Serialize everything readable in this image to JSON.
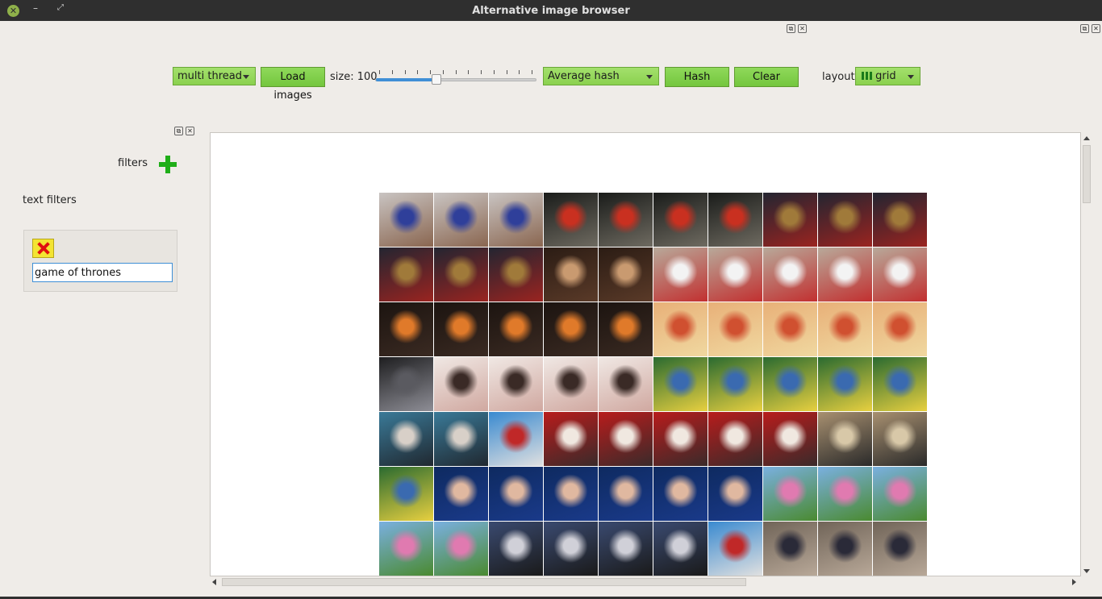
{
  "window": {
    "title": "Alternative image browser",
    "close_glyph": "✕",
    "minimize_glyph": "–",
    "maximize_glyph": "⤢"
  },
  "dock": {
    "float_glyph": "⧉",
    "close_glyph": "✕"
  },
  "toolbar": {
    "thread_mode": "multi thread",
    "load_button": "Load images",
    "size_label": "size: 100",
    "size_value": 100,
    "slider_fraction": 0.38,
    "hash_method": "Average hash",
    "hash_button": "Hash",
    "clear_button": "Clear",
    "layout_label": "layout",
    "layout_value": "grid",
    "layout_icon": "grid-icon"
  },
  "sidebar": {
    "filters_label": "filters",
    "add_icon": "plus-icon",
    "text_filters_label": "text filters",
    "filter_item": {
      "remove_icon": "x-icon",
      "value": "game of thrones"
    }
  },
  "grid": {
    "columns": 10,
    "thumbnails": [
      [
        "phone-hand",
        "phone-hand",
        "phone-hand",
        "scoreboard",
        "scoreboard",
        "scoreboard",
        "scoreboard",
        "arcade-machine",
        "arcade-machine",
        "arcade-machine"
      ],
      [
        "arcade-machine",
        "arcade-machine",
        "arcade-machine",
        "portrait-woman",
        "portrait-woman",
        "football-player",
        "football-player",
        "football-player",
        "football-player",
        "football-player"
      ],
      [
        "fire-cave",
        "fire-cave",
        "fire-cave",
        "fire-cave",
        "fire-cave",
        "cartoon-battle",
        "cartoon-battle",
        "cartoon-battle",
        "cartoon-battle",
        "cartoon-battle"
      ],
      [
        "vr-dark",
        "man-silhouette",
        "man-silhouette",
        "man-silhouette",
        "man-silhouette",
        "toy-garden",
        "toy-garden",
        "toy-garden",
        "toy-garden",
        "toy-garden"
      ],
      [
        "vr-headset",
        "vr-headset",
        "soccer-highfive",
        "crowd-red",
        "crowd-red",
        "crowd-red",
        "crowd-red",
        "crowd-red",
        "boxes-sign",
        "boxes-sign"
      ],
      [
        "toy-garden",
        "man-blue-suit",
        "man-blue-suit",
        "man-blue-suit",
        "man-blue-suit",
        "man-blue-suit",
        "man-blue-suit",
        "city-festival",
        "city-festival",
        "city-festival"
      ],
      [
        "city-festival",
        "city-festival",
        "sprinter-stadium",
        "sprinter-stadium",
        "sprinter-stadium",
        "sprinter-stadium",
        "soccer-highfive",
        "wheelchair-racer",
        "wheelchair-racer",
        "wheelchair-racer"
      ]
    ]
  },
  "thumb_colors": {
    "phone-hand": [
      "#c9c4c2",
      "#2f3f9a",
      "#8a6650"
    ],
    "scoreboard": [
      "#1a1c1a",
      "#c93020",
      "#6e6a60"
    ],
    "arcade-machine": [
      "#232531",
      "#a07a3a",
      "#9a2420"
    ],
    "portrait-woman": [
      "#2b1c14",
      "#c99a70",
      "#5a3a28"
    ],
    "football-player": [
      "#b8a99a",
      "#f3f3f3",
      "#c23030"
    ],
    "fire-cave": [
      "#1c1410",
      "#e07a2a",
      "#3a2a22"
    ],
    "cartoon-battle": [
      "#e8b078",
      "#d05030",
      "#f0d8a0"
    ],
    "vr-dark": [
      "#1e1e20",
      "#5a5a60",
      "#8e8e96"
    ],
    "man-silhouette": [
      "#f0e8e4",
      "#3a2a26",
      "#d0a8a0"
    ],
    "toy-garden": [
      "#2a6a30",
      "#3a6ab0",
      "#e8d040"
    ],
    "vr-headset": [
      "#3a7a98",
      "#d8d0c8",
      "#202830"
    ],
    "soccer-highfive": [
      "#3a8ad0",
      "#c02828",
      "#e0e0e0"
    ],
    "crowd-red": [
      "#b81c1c",
      "#f0e8e0",
      "#3a2a2a"
    ],
    "boxes-sign": [
      "#a89070",
      "#d8c8a8",
      "#2a2a2a"
    ],
    "man-blue-suit": [
      "#0e2a60",
      "#e0b8a0",
      "#1a3a8a"
    ],
    "city-festival": [
      "#7ab0e0",
      "#e07ab0",
      "#4a8a30"
    ],
    "sprinter-stadium": [
      "#3a4a70",
      "#d0d0d8",
      "#1a1a1a"
    ],
    "wheelchair-racer": [
      "#706458",
      "#2a2a38",
      "#b8a898"
    ]
  }
}
